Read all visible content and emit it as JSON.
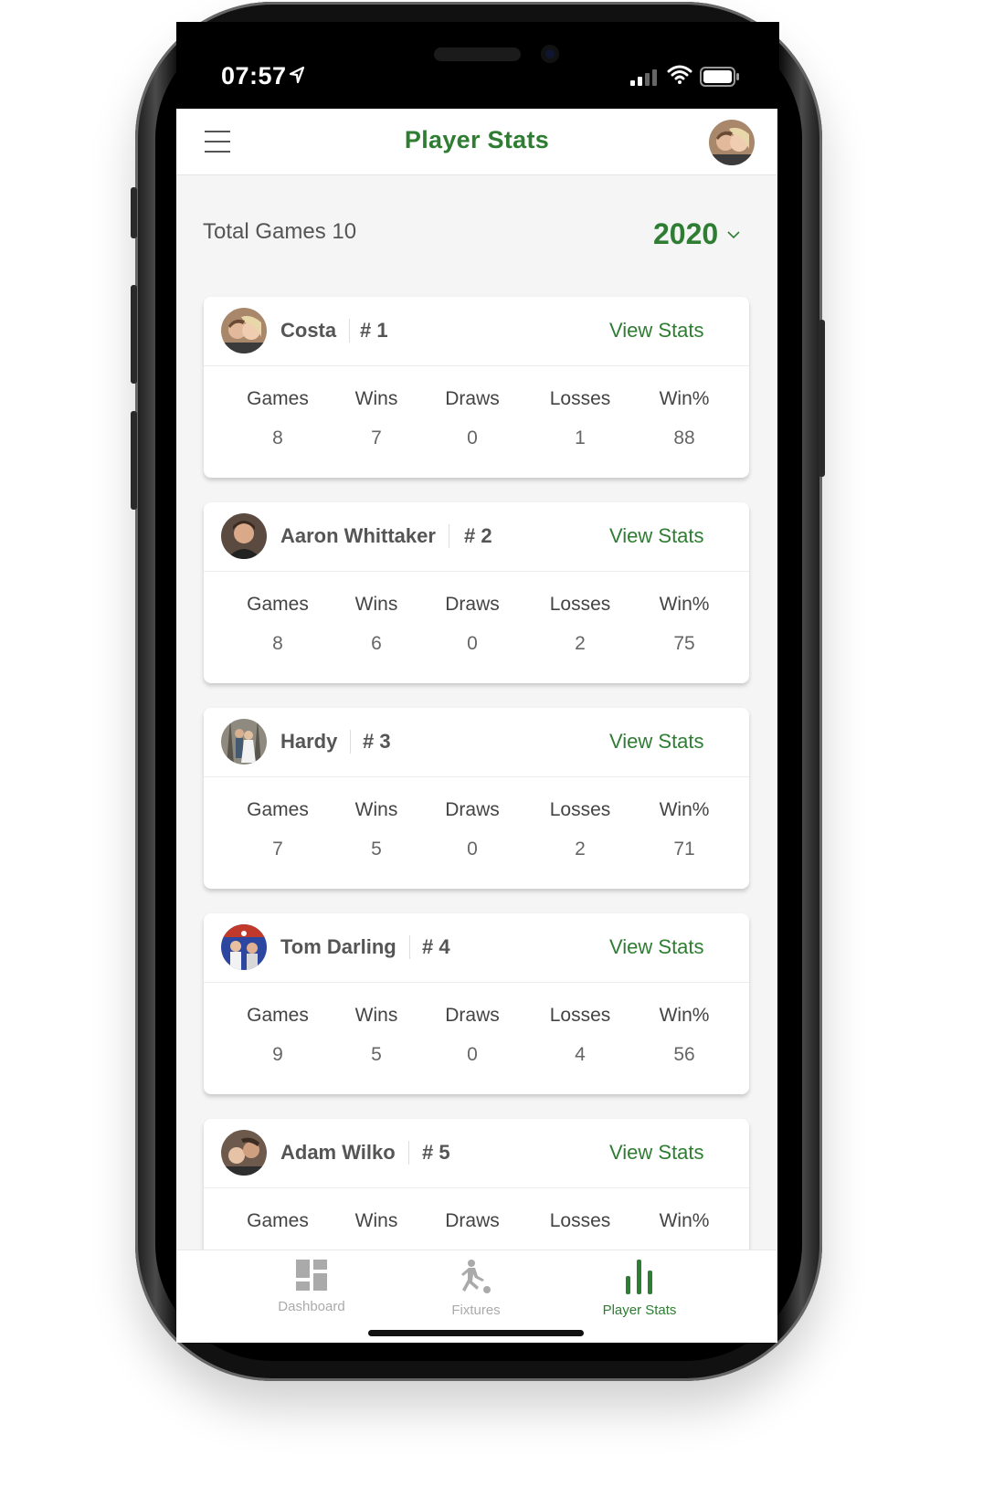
{
  "status": {
    "time": "07:57"
  },
  "header": {
    "title": "Player Stats"
  },
  "summary": {
    "total_games_label": "Total Games 10",
    "year": "2020"
  },
  "columns": [
    "Games",
    "Wins",
    "Draws",
    "Losses",
    "Win%"
  ],
  "view_stats_label": "View Stats",
  "players": [
    {
      "name": "Costa",
      "rank": "# 1",
      "stats": [
        "8",
        "7",
        "0",
        "1",
        "88"
      ]
    },
    {
      "name": "Aaron Whittaker",
      "rank": "# 2",
      "stats": [
        "8",
        "6",
        "0",
        "2",
        "75"
      ]
    },
    {
      "name": "Hardy",
      "rank": "# 3",
      "stats": [
        "7",
        "5",
        "0",
        "2",
        "71"
      ]
    },
    {
      "name": "Tom Darling",
      "rank": "# 4",
      "stats": [
        "9",
        "5",
        "0",
        "4",
        "56"
      ]
    },
    {
      "name": "Adam Wilko",
      "rank": "# 5",
      "stats": [
        "",
        "",
        "",
        "",
        ""
      ]
    }
  ],
  "tabs": [
    {
      "label": "Dashboard",
      "icon": "dashboard-icon",
      "active": false
    },
    {
      "label": "Fixtures",
      "icon": "fixtures-icon",
      "active": false
    },
    {
      "label": "Player Stats",
      "icon": "bar-chart-icon",
      "active": true
    }
  ],
  "colors": {
    "accent": "#2e7d32",
    "inactive": "#aaaaaa"
  }
}
